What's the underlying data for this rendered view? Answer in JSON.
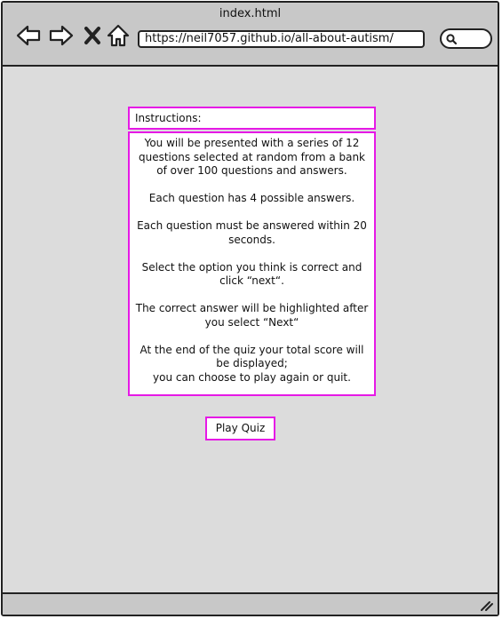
{
  "browser": {
    "title": "index.html",
    "url": "https://neil7057.github.io/all-about-autism/",
    "icons": {
      "back": "back-arrow-icon",
      "forward": "forward-arrow-icon",
      "close": "close-icon",
      "home": "home-icon",
      "search": "search-icon",
      "resize": "resize-grip-icon"
    }
  },
  "instructions": {
    "header": "Instructions:",
    "paragraphs": [
      "You will be presented with a series of 12 questions selected at random from a bank of over 100 questions and answers.",
      "Each question has 4 possible answers.",
      "Each question must be answered within 20 seconds.",
      "Select the option you think is correct and click “next“.",
      "The correct answer will be highlighted after you select “Next“",
      "At the end of the quiz your total score will be displayed;",
      "you can choose to play again or quit."
    ]
  },
  "play_button": {
    "label": "Play Quiz"
  },
  "colors": {
    "accent": "#e619e6",
    "window_bg": "#dcdcdc",
    "chrome_bg": "#c8c8c8"
  }
}
